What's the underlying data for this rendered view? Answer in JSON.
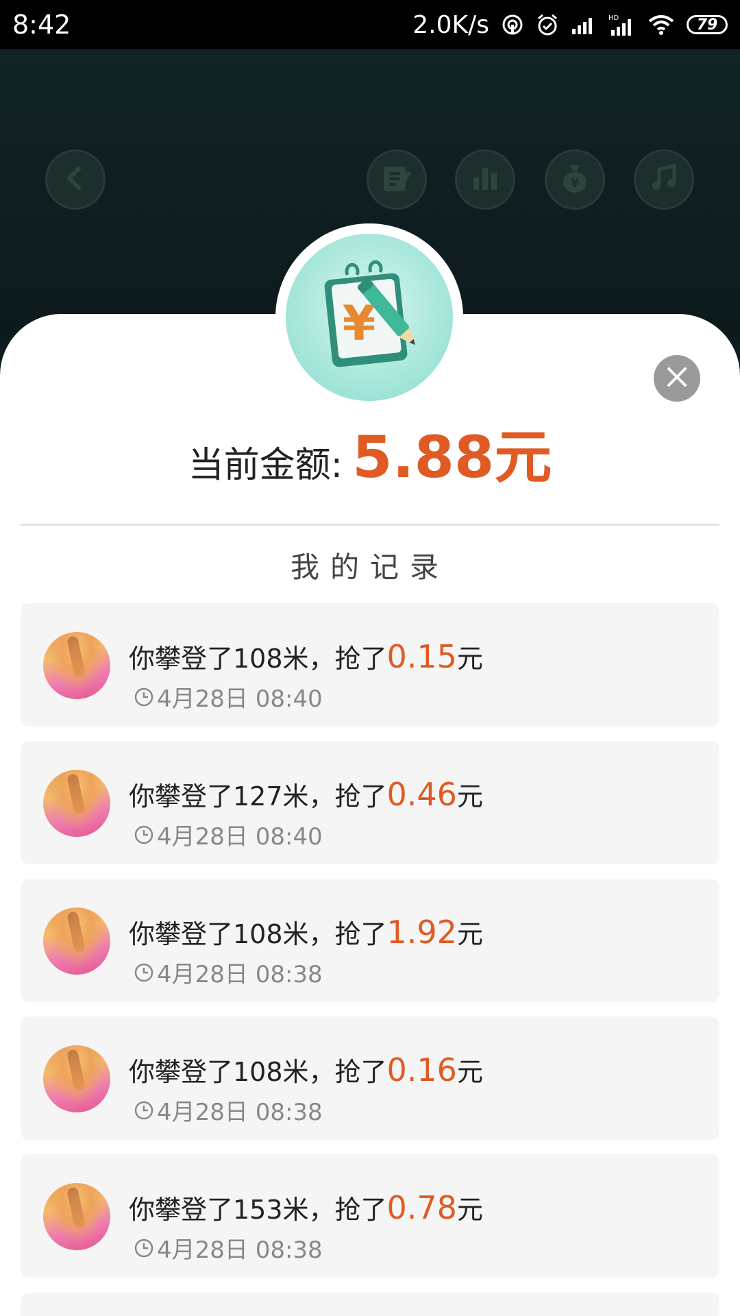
{
  "status_bar": {
    "time": "8:42",
    "net_speed": "2.0K/s",
    "battery": "79",
    "icons": [
      "hotspot-icon",
      "alarm-icon",
      "signal-icon",
      "hd-signal-icon",
      "wifi-icon",
      "battery-icon"
    ]
  },
  "header": {
    "buttons": [
      "back-icon",
      "note-icon",
      "chart-icon",
      "money-bag-icon",
      "music-icon"
    ]
  },
  "balance": {
    "label": "当前金额:",
    "value": "5.88元"
  },
  "section_title": "我的记录",
  "records": [
    {
      "prefix": "你攀登了108米，抢了",
      "money": "0.15",
      "suffix": "元",
      "time": "4月28日 08:40"
    },
    {
      "prefix": "你攀登了127米，抢了",
      "money": "0.46",
      "suffix": "元",
      "time": "4月28日 08:40"
    },
    {
      "prefix": "你攀登了108米，抢了",
      "money": "1.92",
      "suffix": "元",
      "time": "4月28日 08:38"
    },
    {
      "prefix": "你攀登了108米，抢了",
      "money": "0.16",
      "suffix": "元",
      "time": "4月28日 08:38"
    },
    {
      "prefix": "你攀登了153米，抢了",
      "money": "0.78",
      "suffix": "元",
      "time": "4月28日 08:38"
    }
  ],
  "colors": {
    "accent": "#e05a24",
    "card_bg": "#f5f5f5",
    "header_bg": "#112326"
  }
}
